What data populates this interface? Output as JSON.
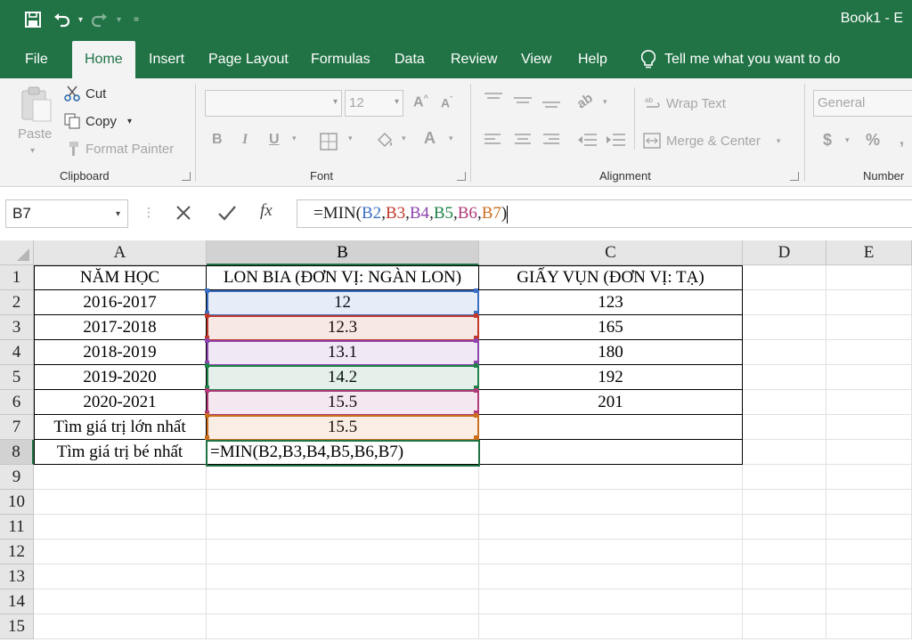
{
  "title_bar": {
    "title": "Book1  -  E"
  },
  "menu_tabs": [
    "File",
    "Home",
    "Insert",
    "Page Layout",
    "Formulas",
    "Data",
    "Review",
    "View",
    "Help"
  ],
  "tell_me": "Tell me what you want to do",
  "ribbon": {
    "clipboard": {
      "paste": "Paste",
      "cut": "Cut",
      "copy": "Copy",
      "format_painter": "Format Painter",
      "label": "Clipboard"
    },
    "font": {
      "font_name": "",
      "font_size": "12",
      "label": "Font"
    },
    "alignment": {
      "wrap_text": "Wrap Text",
      "merge_center": "Merge & Center",
      "label": "Alignment"
    },
    "number": {
      "format": "General",
      "currency": "$",
      "percent": "%",
      "comma": ",",
      "label": "Number"
    }
  },
  "formula_bar": {
    "name_box": "B7",
    "fx": "fx",
    "formula_parts": [
      {
        "text": "=MIN(",
        "color": "#222222"
      },
      {
        "text": "B2",
        "color": "#3a6fc4"
      },
      {
        "text": ",",
        "color": "#222222"
      },
      {
        "text": "B3",
        "color": "#c0392b"
      },
      {
        "text": ",",
        "color": "#222222"
      },
      {
        "text": "B4",
        "color": "#8e44ad"
      },
      {
        "text": ",",
        "color": "#222222"
      },
      {
        "text": "B5",
        "color": "#1e8449"
      },
      {
        "text": ",",
        "color": "#222222"
      },
      {
        "text": "B6",
        "color": "#b03a7a"
      },
      {
        "text": ",",
        "color": "#222222"
      },
      {
        "text": "B7",
        "color": "#ca6f1e"
      },
      {
        "text": ")",
        "color": "#222222"
      }
    ]
  },
  "columns": [
    "A",
    "B",
    "C",
    "D",
    "E"
  ],
  "rows": [
    "1",
    "2",
    "3",
    "4",
    "5",
    "6",
    "7",
    "8",
    "9",
    "10",
    "11",
    "12",
    "13",
    "14",
    "15"
  ],
  "cells": {
    "A1": "NĂM HỌC",
    "B1": "LON BIA (ĐƠN VỊ: NGÀN LON)",
    "C1": "GIẤY VỤN (ĐƠN VỊ: TẠ)",
    "A2": "2016-2017",
    "B2": "12",
    "C2": "123",
    "A3": "2017-2018",
    "B3": "12.3",
    "C3": "165",
    "A4": "2018-2019",
    "B4": "13.1",
    "C4": "180",
    "A5": "2019-2020",
    "B5": "14.2",
    "C5": "192",
    "A6": "2020-2021",
    "B6": "15.5",
    "C6": "201",
    "A7": "Tìm giá trị lớn nhất",
    "B7": "15.5",
    "A8": "Tìm giá trị bé nhất",
    "B8": "=MIN(B2,B3,B4,B5,B6,B7)"
  },
  "colors": {
    "excel_green": "#217346",
    "ref_b2": "#3a6fc4",
    "ref_b3": "#c0392b",
    "ref_b4": "#8e44ad",
    "ref_b5": "#1e8449",
    "ref_b6": "#b03a7a",
    "ref_b7": "#ca6f1e"
  }
}
